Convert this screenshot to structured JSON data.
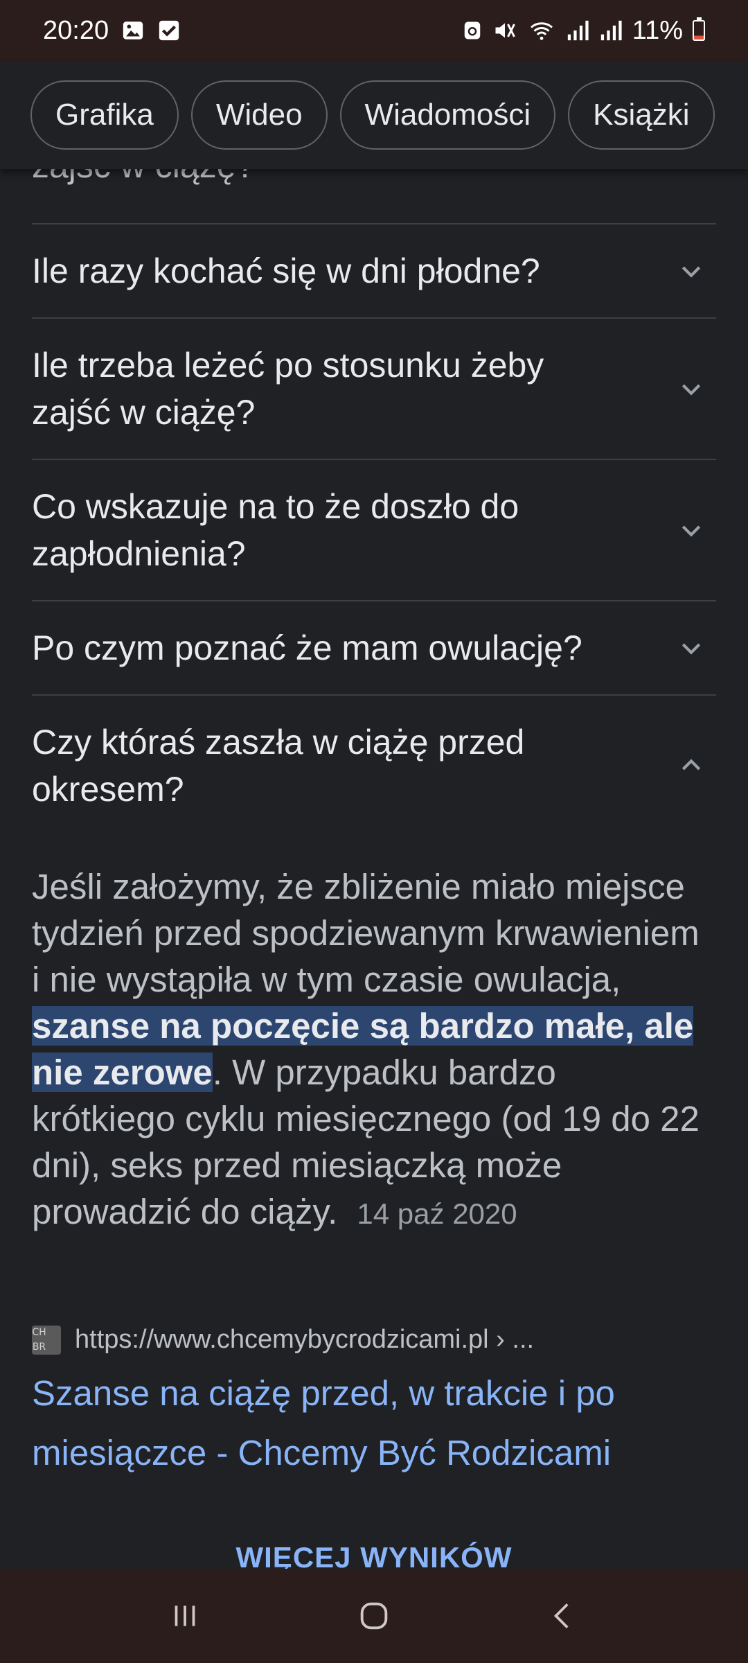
{
  "status": {
    "time": "20:20",
    "battery": "11%"
  },
  "chips": [
    "Grafika",
    "Wideo",
    "Wiadomości",
    "Książki"
  ],
  "partial_question": "zajść w ciążę?",
  "faq": [
    {
      "question": "Ile razy kochać się w dni płodne?",
      "expanded": false
    },
    {
      "question": "Ile trzeba leżeć po stosunku żeby zajść w ciążę?",
      "expanded": false
    },
    {
      "question": "Co wskazuje na to że doszło do zapłodnienia?",
      "expanded": false
    },
    {
      "question": "Po czym poznać że mam owulację?",
      "expanded": false
    },
    {
      "question": "Czy któraś zaszła w ciążę przed okresem?",
      "expanded": true
    }
  ],
  "answer": {
    "before": "Jeśli założymy, że zbliżenie miało miejsce tydzień przed spodziewanym krwawieniem i nie wystąpiła w tym czasie owulacja, ",
    "highlight": "szanse na poczęcie są bardzo małe, ale nie zerowe",
    "after": ". W przypadku bardzo krótkiego cyklu miesięcznego (od 19 do 22 dni), seks przed miesiączką może prowadzić do ciąży.",
    "date": "14 paź 2020"
  },
  "source": {
    "favicon_text": [
      "CH",
      "BR"
    ],
    "url": "https://www.chcemybycrodzicami.pl › ...",
    "title": "Szanse na ciążę przed, w trakcie i po miesiączce - Chcemy Być Rodzicami"
  },
  "more_results": "WIĘCEJ WYNIKÓW"
}
